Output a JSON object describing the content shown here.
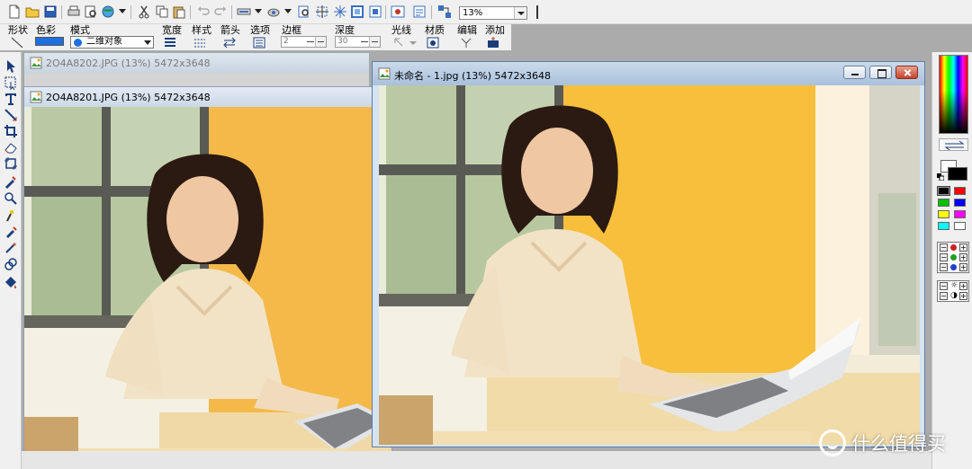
{
  "toolbar": {
    "zoom_value": "13%",
    "labels": {
      "shape": "形状",
      "color": "色彩",
      "mode": "模式",
      "width": "宽度",
      "style": "样式",
      "arrow": "箭头",
      "options": "选项",
      "border": "边框",
      "depth": "深度",
      "light": "光线",
      "material": "材质",
      "edit": "编辑",
      "add": "添加"
    },
    "mode_value": "二维对象",
    "border_value": "2",
    "depth_value": "30",
    "accent_color": "#1e6fe0"
  },
  "windows": [
    {
      "title": "2O4A8202.JPG (13%) 5472x3648"
    },
    {
      "title": "2O4A8201.JPG (13%) 5472x3648"
    },
    {
      "title": "未命名 - 1.jpg (13%) 5472x3648"
    }
  ],
  "palette": {
    "foreground": "#000000",
    "background": "#ffffff",
    "swatches": [
      "#000000",
      "#ff0000",
      "#00c000",
      "#0000ff",
      "#ffff00",
      "#ff00ff",
      "#00ffff",
      "#ffffff"
    ]
  },
  "watermark": {
    "text": "什么值得买",
    "icon": "smile-logo-icon"
  }
}
